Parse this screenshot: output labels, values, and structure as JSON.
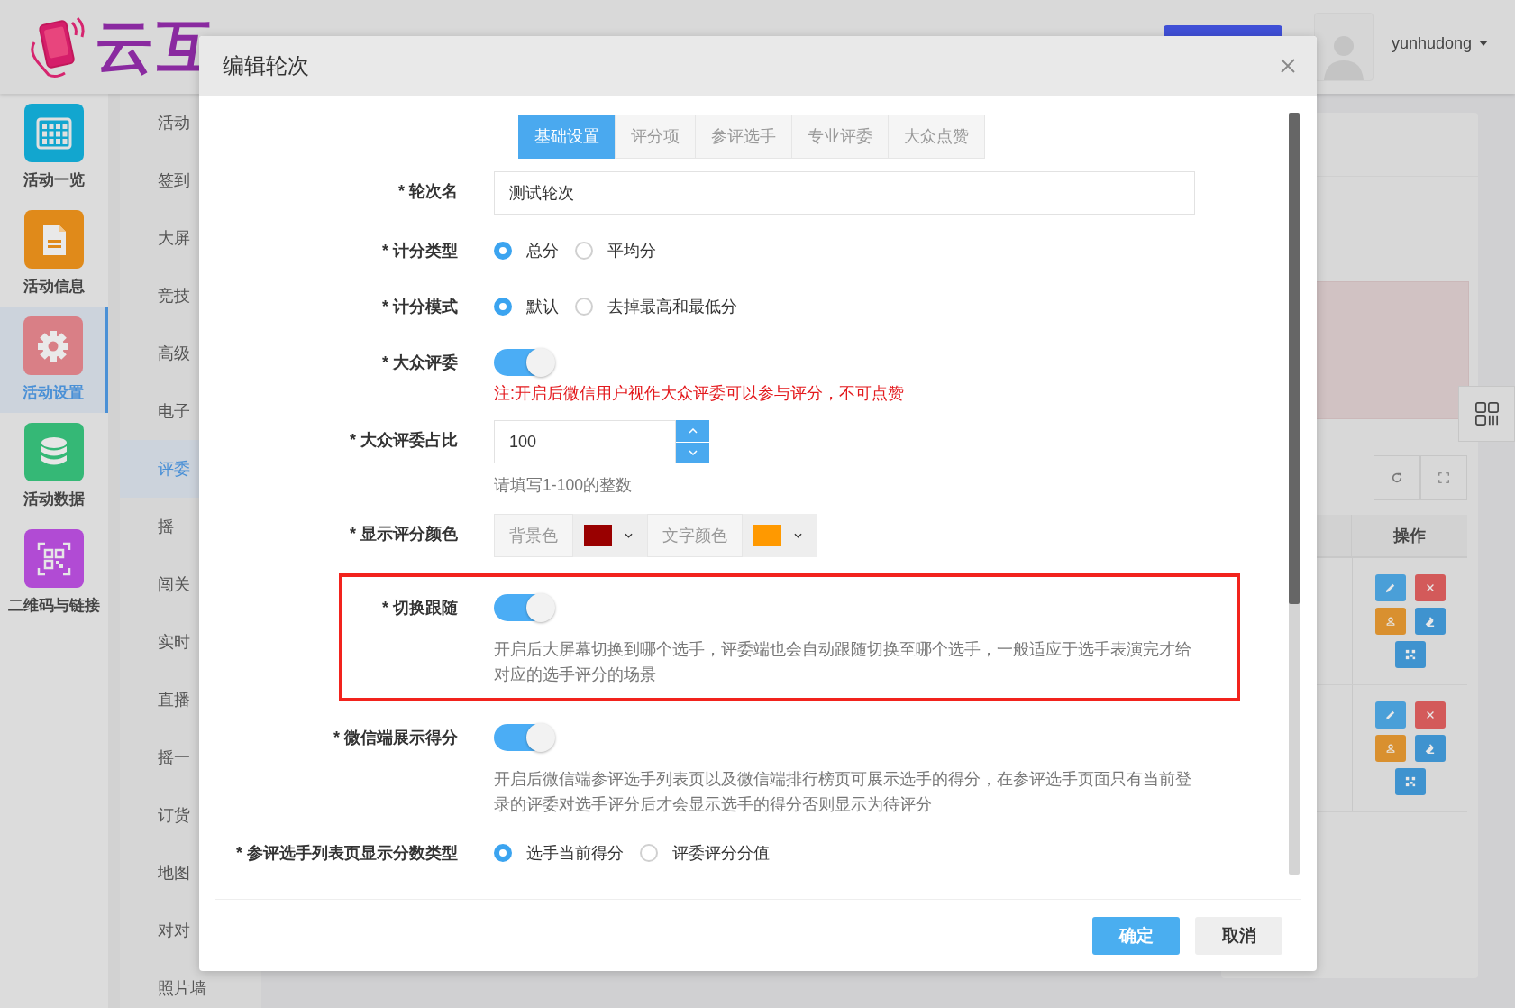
{
  "header": {
    "logo_text": "云互",
    "user": {
      "name": "yunhudong"
    }
  },
  "icon_nav": [
    {
      "label": "活动一览",
      "kind": "grid",
      "color": "#12a6cf",
      "selected": false
    },
    {
      "label": "活动信息",
      "kind": "document",
      "color": "#e08a1a",
      "selected": false
    },
    {
      "label": "活动设置",
      "kind": "gear",
      "color": "#d97f86",
      "selected": true
    },
    {
      "label": "活动数据",
      "kind": "database",
      "color": "#35b876",
      "selected": false
    },
    {
      "label": "二维码与链接",
      "kind": "qr",
      "color": "#b14bd4",
      "selected": false
    }
  ],
  "menu": [
    {
      "label": "活动",
      "selected": false
    },
    {
      "label": "签到",
      "selected": false
    },
    {
      "label": "大屏",
      "selected": false
    },
    {
      "label": "竞技",
      "selected": false
    },
    {
      "label": "高级",
      "selected": false
    },
    {
      "label": "电子",
      "selected": false
    },
    {
      "label": "评委",
      "selected": true
    },
    {
      "label": "摇",
      "selected": false
    },
    {
      "label": "闯关",
      "selected": false
    },
    {
      "label": "实时",
      "selected": false
    },
    {
      "label": "直播",
      "selected": false
    },
    {
      "label": "摇一",
      "selected": false
    },
    {
      "label": "订货",
      "selected": false
    },
    {
      "label": "地图",
      "selected": false
    },
    {
      "label": "对对",
      "selected": false
    },
    {
      "label": "照片墙",
      "selected": false
    }
  ],
  "table": {
    "columns": [
      "操作"
    ],
    "rows": [
      {
        "kind": "actions"
      },
      {
        "kind": "actions"
      }
    ]
  },
  "dialog": {
    "title": "编辑轮次",
    "tabs": [
      {
        "label": "基础设置",
        "selected": true
      },
      {
        "label": "评分项",
        "selected": false
      },
      {
        "label": "参评选手",
        "selected": false
      },
      {
        "label": "专业评委",
        "selected": false
      },
      {
        "label": "大众点赞",
        "selected": false
      }
    ],
    "fields": [
      {
        "kind": "text",
        "label": "* 轮次名",
        "value": "测试轮次"
      },
      {
        "kind": "radio",
        "label": "* 计分类型",
        "options": [
          {
            "label": "总分",
            "selected": true
          },
          {
            "label": "平均分",
            "selected": false
          }
        ]
      },
      {
        "kind": "radio",
        "label": "* 计分模式",
        "options": [
          {
            "label": "默认",
            "selected": true
          },
          {
            "label": "去掉最高和最低分",
            "selected": false
          }
        ]
      },
      {
        "kind": "switch",
        "label": "* 大众评委",
        "on": true,
        "warning": "注:开启后微信用户视作大众评委可以参与评分，不可点赞"
      },
      {
        "kind": "number",
        "label": "* 大众评委占比",
        "value": "100",
        "help": "请填写1-100的整数"
      },
      {
        "kind": "colors",
        "label": "* 显示评分颜色",
        "pickers": [
          {
            "label": "背景色",
            "color": "#990000"
          },
          {
            "label": "文字颜色",
            "color": "#ff9900"
          }
        ]
      },
      {
        "kind": "switch",
        "label": "* 切换跟随",
        "on": true,
        "highlighted": true,
        "help": "开启后大屏幕切换到哪个选手，评委端也会自动跟随切换至哪个选手，一般适应于选手表演完才给对应的选手评分的场景"
      },
      {
        "kind": "switch",
        "label": "* 微信端展示得分",
        "on": true,
        "help": "开启后微信端参评选手列表页以及微信端排行榜页可展示选手的得分，在参评选手页面只有当前登录的评委对选手评分后才会显示选手的得分否则显示为待评分"
      },
      {
        "kind": "radio",
        "label": "* 参评选手列表页显示分数类型",
        "options": [
          {
            "label": "选手当前得分",
            "selected": true
          },
          {
            "label": "评委评分分值",
            "selected": false
          }
        ]
      }
    ],
    "buttons": [
      {
        "label": "确定",
        "kind": "primary"
      },
      {
        "label": "取消",
        "kind": "default"
      }
    ]
  }
}
